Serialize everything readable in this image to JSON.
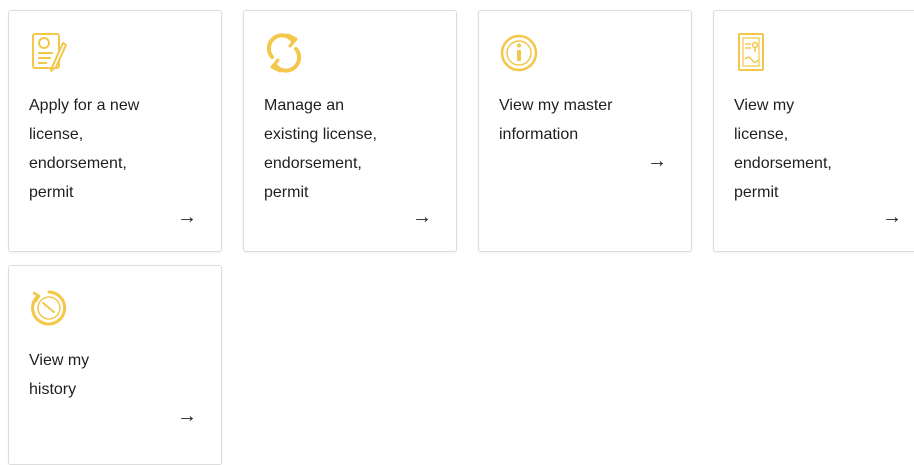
{
  "accent_color": "#f3c74a",
  "arrow_glyph": "→",
  "cards": [
    {
      "label": "Apply for a new\nlicense,\nendorsement,\npermit",
      "icon": "license-application-icon"
    },
    {
      "label": "Manage an\nexisting license,\nendorsement,\npermit",
      "icon": "refresh-icon"
    },
    {
      "label": "View my master\ninformation",
      "icon": "info-icon"
    },
    {
      "label": "View my\nlicense,\nendorsement,\npermit",
      "icon": "certificate-icon"
    },
    {
      "label": "View my\nhistory",
      "icon": "history-clock-icon"
    }
  ]
}
